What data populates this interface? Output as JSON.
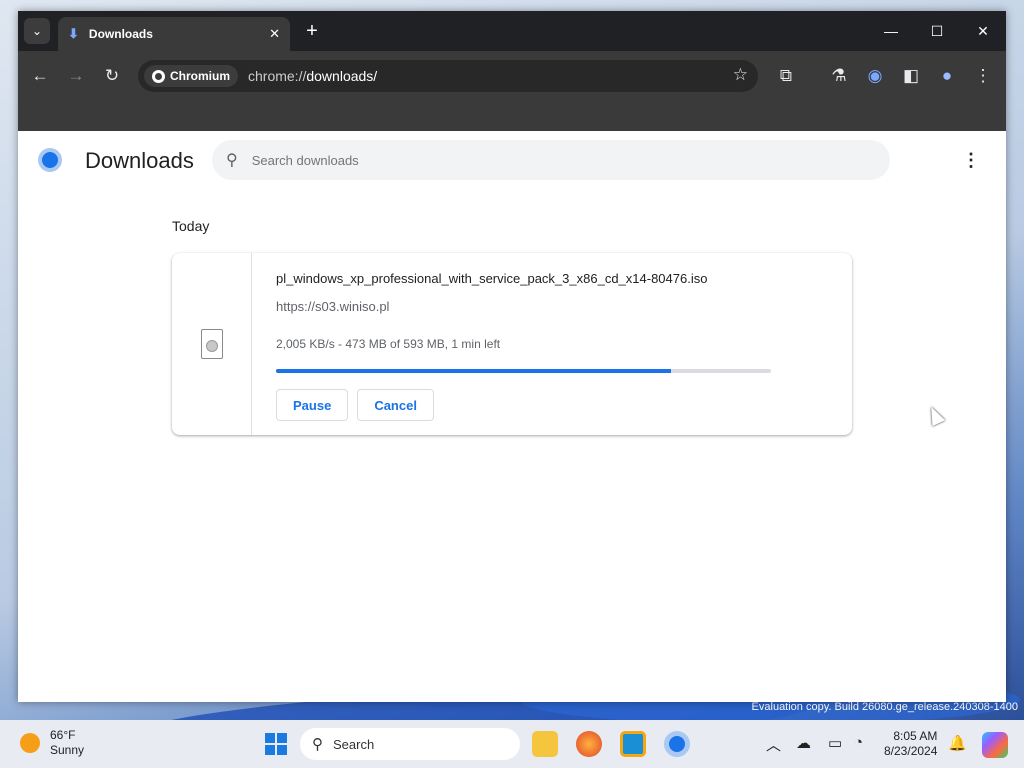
{
  "browser": {
    "tab_title": "Downloads",
    "chip_label": "Chromium",
    "url_prefix": "chrome://",
    "url_path": "downloads/"
  },
  "page": {
    "title": "Downloads",
    "search_placeholder": "Search downloads",
    "group_label": "Today"
  },
  "download": {
    "filename": "pl_windows_xp_professional_with_service_pack_3_x86_cd_x14-80476.iso",
    "source_url": "https://s03.winiso.pl",
    "status": "2,005 KB/s - 473 MB of 593 MB, 1 min left",
    "progress": 0.797,
    "pause_label": "Pause",
    "cancel_label": "Cancel"
  },
  "taskbar": {
    "temperature": "66°F",
    "condition": "Sunny",
    "search_label": "Search",
    "time": "8:05 AM",
    "date": "8/23/2024"
  },
  "watermark": "Evaluation copy. Build 26080.ge_release.240308-1400",
  "colors": {
    "accent": "#1a73e8",
    "chrome_dark": "#202124"
  }
}
